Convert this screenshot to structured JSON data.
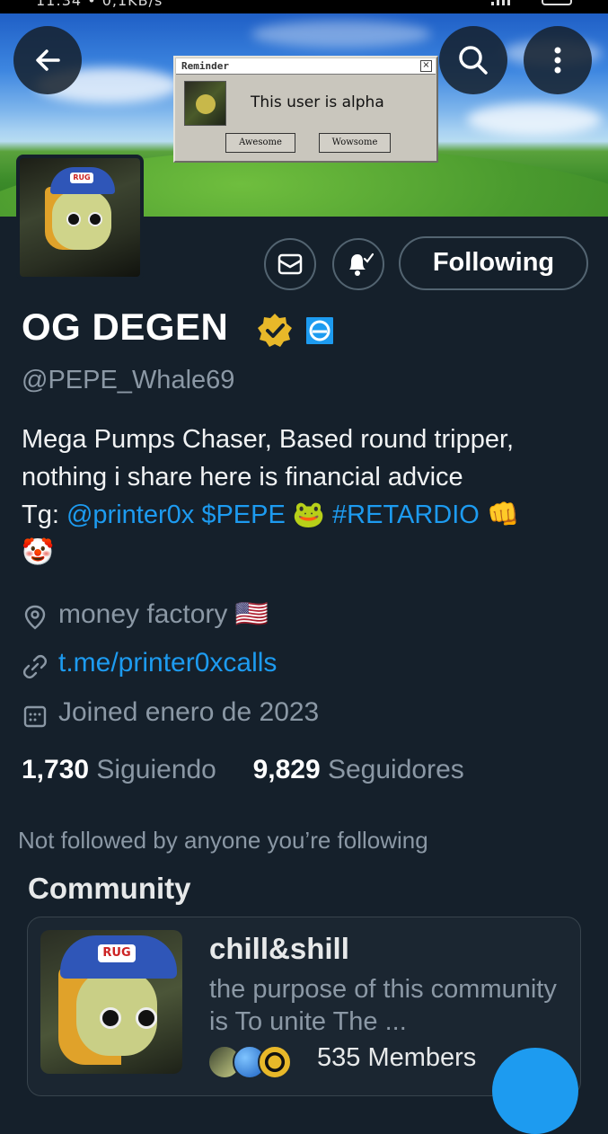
{
  "status_bar": {
    "time": "11:34 • 0,1KB/s"
  },
  "header": {
    "back_icon": "arrow-left-icon",
    "search_icon": "search-icon",
    "more_icon": "more-vertical-icon"
  },
  "banner": {
    "reminder_title": "Reminder",
    "reminder_close": "×",
    "reminder_message": "This user is alpha",
    "button_awesome": "Awesome",
    "button_wowsome": "Wowsome"
  },
  "actions": {
    "message_icon": "envelope-icon",
    "notify_icon": "bell-check-icon",
    "follow_label": "Following"
  },
  "profile": {
    "name": "OG DEGEN",
    "verified_badge": "gold-verified-badge-icon",
    "affiliate_badge": "affiliate-badge-icon",
    "handle": "@PEPE_Whale69",
    "bio_line1": "Mega Pumps Chaser, Based round tripper,",
    "bio_line2": "nothing i share here is financial advice",
    "bio_line3_prefix": "Tg: ",
    "bio_mention": "@printer0x",
    "bio_cashtag": "$PEPE",
    "bio_frog": "🐸",
    "bio_hashtag": "#RETARDIO",
    "bio_fist": "👊",
    "bio_clown": "🤡",
    "location": "money factory 🇺🇸",
    "website": "t.me/printer0xcalls",
    "joined": "Joined enero de 2023",
    "following_count": "1,730",
    "following_label": "Siguiendo",
    "followers_count": "9,829",
    "followers_label": "Seguidores",
    "not_followed_text": "Not followed by anyone you’re following"
  },
  "community": {
    "section_title": "Community",
    "name": "chill&shill",
    "description": "the purpose of this community is To unite The ...",
    "members": "535 Members"
  },
  "colors": {
    "background": "#15202b",
    "accent": "#1d9bf0",
    "muted": "#8b98a5",
    "verified_gold": "#e8b829"
  }
}
